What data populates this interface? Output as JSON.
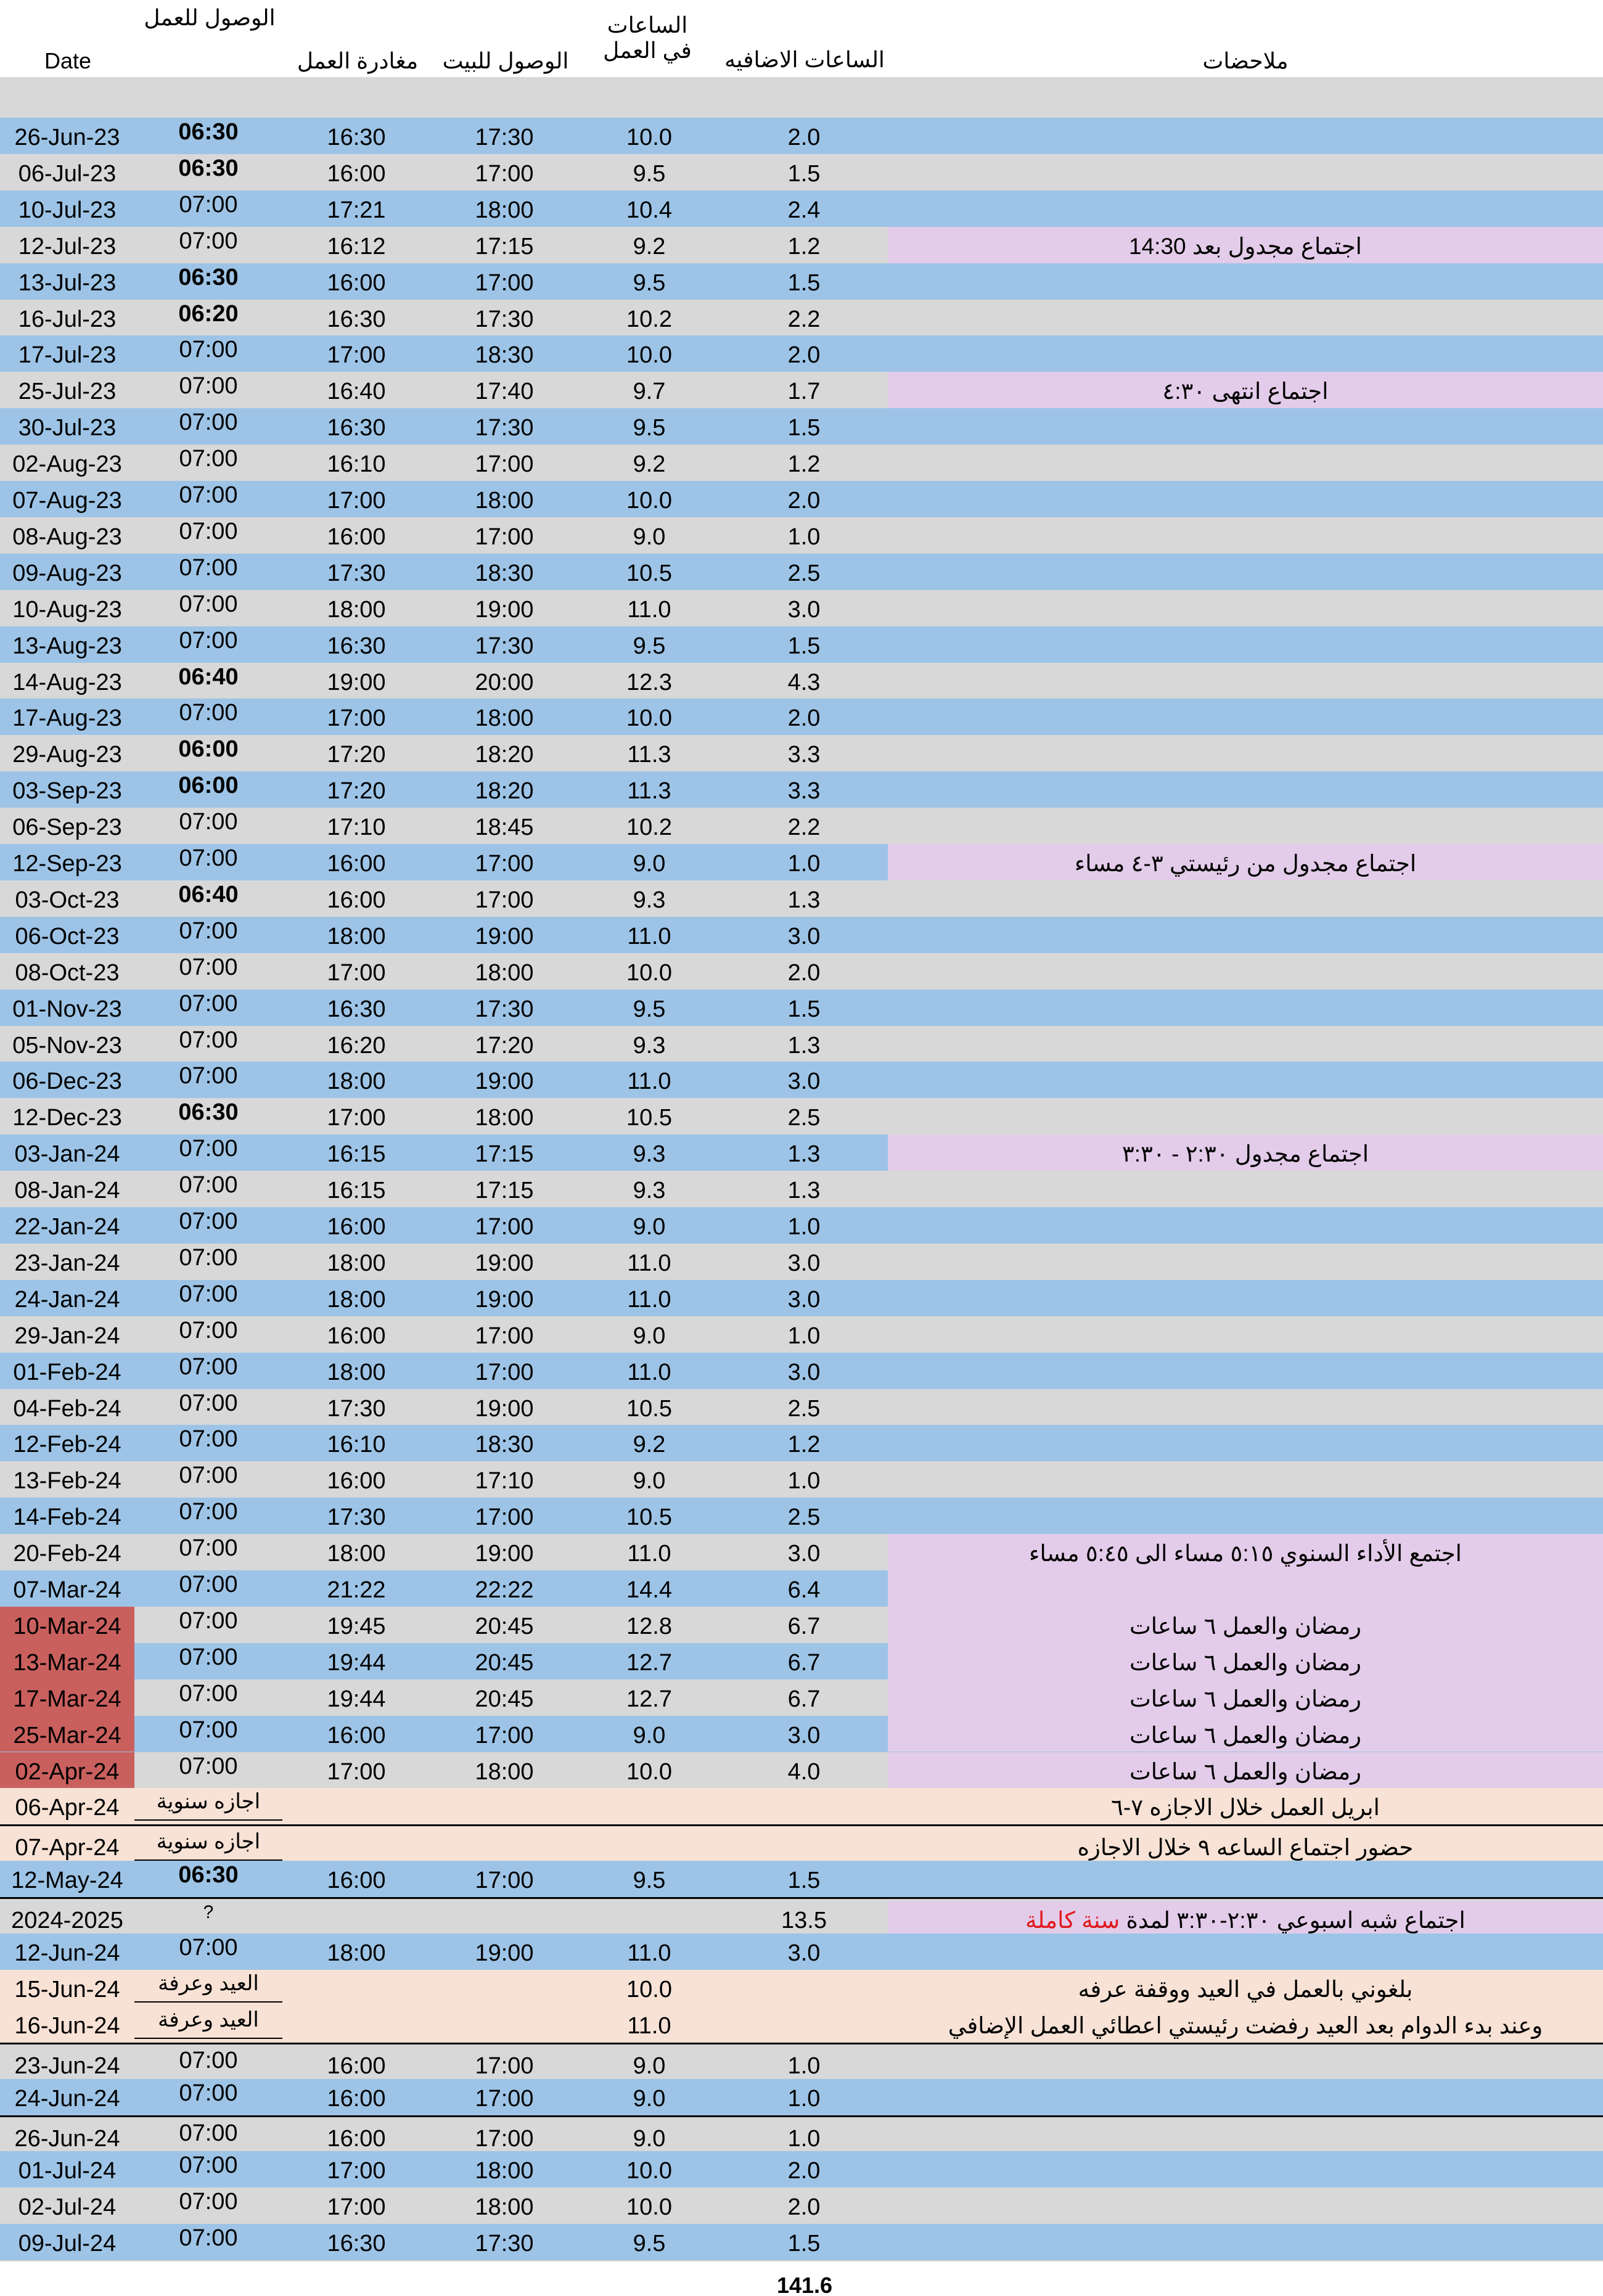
{
  "colors": {
    "blue": "#9dc4e6",
    "gray": "#d8d8d8",
    "purple": "#e3cce9",
    "peach": "#f7e2d5",
    "red_date": "#c9605e",
    "note_red": "#e0191d"
  },
  "headers": {
    "date": "Date",
    "arrive_work": "الوصول للعمل",
    "leave_work": "مغادرة العمل",
    "arrive_home": "الوصول للبيت",
    "hours_work": "الساعات في العمل",
    "overtime": "الساعات الاضافيه",
    "notes": "ملاحضات"
  },
  "rows": [
    {
      "date": "26-Jun-23",
      "arrive": "06:30",
      "bold": true,
      "leave": "16:30",
      "home": "17:30",
      "hours": "10.0",
      "ot": "2.0",
      "bg": "blue"
    },
    {
      "date": "06-Jul-23",
      "arrive": "06:30",
      "bold": true,
      "leave": "16:00",
      "home": "17:00",
      "hours": "9.5",
      "ot": "1.5",
      "bg": "gray"
    },
    {
      "date": "10-Jul-23",
      "arrive": "07:00",
      "leave": "17:21",
      "home": "18:00",
      "hours": "10.4",
      "ot": "2.4",
      "bg": "blue"
    },
    {
      "date": "12-Jul-23",
      "arrive": "07:00",
      "leave": "16:12",
      "home": "17:15",
      "hours": "9.2",
      "ot": "1.2",
      "bg": "gray",
      "note": "اجتماع مجدول بعد 14:30",
      "note_bg": "purple"
    },
    {
      "date": "13-Jul-23",
      "arrive": "06:30",
      "bold": true,
      "leave": "16:00",
      "home": "17:00",
      "hours": "9.5",
      "ot": "1.5",
      "bg": "blue"
    },
    {
      "date": "16-Jul-23",
      "arrive": "06:20",
      "bold": true,
      "leave": "16:30",
      "home": "17:30",
      "hours": "10.2",
      "ot": "2.2",
      "bg": "gray"
    },
    {
      "date": "17-Jul-23",
      "arrive": "07:00",
      "leave": "17:00",
      "home": "18:30",
      "hours": "10.0",
      "ot": "2.0",
      "bg": "blue"
    },
    {
      "date": "25-Jul-23",
      "arrive": "07:00",
      "leave": "16:40",
      "home": "17:40",
      "hours": "9.7",
      "ot": "1.7",
      "bg": "gray",
      "note": "اجتماع انتهى ٤:٣٠",
      "note_bg": "purple"
    },
    {
      "date": "30-Jul-23",
      "arrive": "07:00",
      "leave": "16:30",
      "home": "17:30",
      "hours": "9.5",
      "ot": "1.5",
      "bg": "blue"
    },
    {
      "date": "02-Aug-23",
      "arrive": "07:00",
      "leave": "16:10",
      "home": "17:00",
      "hours": "9.2",
      "ot": "1.2",
      "bg": "gray"
    },
    {
      "date": "07-Aug-23",
      "arrive": "07:00",
      "leave": "17:00",
      "home": "18:00",
      "hours": "10.0",
      "ot": "2.0",
      "bg": "blue"
    },
    {
      "date": "08-Aug-23",
      "arrive": "07:00",
      "leave": "16:00",
      "home": "17:00",
      "hours": "9.0",
      "ot": "1.0",
      "bg": "gray"
    },
    {
      "date": "09-Aug-23",
      "arrive": "07:00",
      "leave": "17:30",
      "home": "18:30",
      "hours": "10.5",
      "ot": "2.5",
      "bg": "blue"
    },
    {
      "date": "10-Aug-23",
      "arrive": "07:00",
      "leave": "18:00",
      "home": "19:00",
      "hours": "11.0",
      "ot": "3.0",
      "bg": "gray"
    },
    {
      "date": "13-Aug-23",
      "arrive": "07:00",
      "leave": "16:30",
      "home": "17:30",
      "hours": "9.5",
      "ot": "1.5",
      "bg": "blue"
    },
    {
      "date": "14-Aug-23",
      "arrive": "06:40",
      "bold": true,
      "leave": "19:00",
      "home": "20:00",
      "hours": "12.3",
      "ot": "4.3",
      "bg": "gray"
    },
    {
      "date": "17-Aug-23",
      "arrive": "07:00",
      "leave": "17:00",
      "home": "18:00",
      "hours": "10.0",
      "ot": "2.0",
      "bg": "blue"
    },
    {
      "date": "29-Aug-23",
      "arrive": "06:00",
      "bold": true,
      "leave": "17:20",
      "home": "18:20",
      "hours": "11.3",
      "ot": "3.3",
      "bg": "gray"
    },
    {
      "date": "03-Sep-23",
      "arrive": "06:00",
      "bold": true,
      "leave": "17:20",
      "home": "18:20",
      "hours": "11.3",
      "ot": "3.3",
      "bg": "blue"
    },
    {
      "date": "06-Sep-23",
      "arrive": "07:00",
      "leave": "17:10",
      "home": "18:45",
      "hours": "10.2",
      "ot": "2.2",
      "bg": "gray"
    },
    {
      "date": "12-Sep-23",
      "arrive": "07:00",
      "leave": "16:00",
      "home": "17:00",
      "hours": "9.0",
      "ot": "1.0",
      "bg": "blue",
      "note": "اجتماع مجدول من رئيستي ٣-٤ مساء",
      "note_bg": "purple"
    },
    {
      "date": "03-Oct-23",
      "arrive": "06:40",
      "bold": true,
      "leave": "16:00",
      "home": "17:00",
      "hours": "9.3",
      "ot": "1.3",
      "bg": "gray"
    },
    {
      "date": "06-Oct-23",
      "arrive": "07:00",
      "leave": "18:00",
      "home": "19:00",
      "hours": "11.0",
      "ot": "3.0",
      "bg": "blue"
    },
    {
      "date": "08-Oct-23",
      "arrive": "07:00",
      "leave": "17:00",
      "home": "18:00",
      "hours": "10.0",
      "ot": "2.0",
      "bg": "gray"
    },
    {
      "date": "01-Nov-23",
      "arrive": "07:00",
      "leave": "16:30",
      "home": "17:30",
      "hours": "9.5",
      "ot": "1.5",
      "bg": "blue"
    },
    {
      "date": "05-Nov-23",
      "arrive": "07:00",
      "leave": "16:20",
      "home": "17:20",
      "hours": "9.3",
      "ot": "1.3",
      "bg": "gray"
    },
    {
      "date": "06-Dec-23",
      "arrive": "07:00",
      "leave": "18:00",
      "home": "19:00",
      "hours": "11.0",
      "ot": "3.0",
      "bg": "blue"
    },
    {
      "date": "12-Dec-23",
      "arrive": "06:30",
      "bold": true,
      "leave": "17:00",
      "home": "18:00",
      "hours": "10.5",
      "ot": "2.5",
      "bg": "gray"
    },
    {
      "date": "03-Jan-24",
      "arrive": "07:00",
      "leave": "16:15",
      "home": "17:15",
      "hours": "9.3",
      "ot": "1.3",
      "bg": "blue",
      "note": "اجتماع مجدول ٢:٣٠ - ٣:٣٠",
      "note_bg": "purple"
    },
    {
      "date": "08-Jan-24",
      "arrive": "07:00",
      "leave": "16:15",
      "home": "17:15",
      "hours": "9.3",
      "ot": "1.3",
      "bg": "gray"
    },
    {
      "date": "22-Jan-24",
      "arrive": "07:00",
      "leave": "16:00",
      "home": "17:00",
      "hours": "9.0",
      "ot": "1.0",
      "bg": "blue"
    },
    {
      "date": "23-Jan-24",
      "arrive": "07:00",
      "leave": "18:00",
      "home": "19:00",
      "hours": "11.0",
      "ot": "3.0",
      "bg": "gray"
    },
    {
      "date": "24-Jan-24",
      "arrive": "07:00",
      "leave": "18:00",
      "home": "19:00",
      "hours": "11.0",
      "ot": "3.0",
      "bg": "blue"
    },
    {
      "date": "29-Jan-24",
      "arrive": "07:00",
      "leave": "16:00",
      "home": "17:00",
      "hours": "9.0",
      "ot": "1.0",
      "bg": "gray"
    },
    {
      "date": "01-Feb-24",
      "arrive": "07:00",
      "leave": "18:00",
      "home": "17:00",
      "hours": "11.0",
      "ot": "3.0",
      "bg": "blue"
    },
    {
      "date": "04-Feb-24",
      "arrive": "07:00",
      "leave": "17:30",
      "home": "19:00",
      "hours": "10.5",
      "ot": "2.5",
      "bg": "gray"
    },
    {
      "date": "12-Feb-24",
      "arrive": "07:00",
      "leave": "16:10",
      "home": "18:30",
      "hours": "9.2",
      "ot": "1.2",
      "bg": "blue"
    },
    {
      "date": "13-Feb-24",
      "arrive": "07:00",
      "leave": "16:00",
      "home": "17:10",
      "hours": "9.0",
      "ot": "1.0",
      "bg": "gray"
    },
    {
      "date": "14-Feb-24",
      "arrive": "07:00",
      "leave": "17:30",
      "home": "17:00",
      "hours": "10.5",
      "ot": "2.5",
      "bg": "blue"
    },
    {
      "date": "20-Feb-24",
      "arrive": "07:00",
      "leave": "18:00",
      "home": "19:00",
      "hours": "11.0",
      "ot": "3.0",
      "bg": "gray",
      "note": "اجتمع الأداء السنوي ٥:١٥ مساء الى ٥:٤٥ مساء",
      "note_bg": "purple"
    },
    {
      "date": "07-Mar-24",
      "arrive": "07:00",
      "leave": "21:22",
      "home": "22:22",
      "hours": "14.4",
      "ot": "6.4",
      "bg": "blue",
      "note_bg": "purple"
    },
    {
      "date": "10-Mar-24",
      "arrive": "07:00",
      "leave": "19:45",
      "home": "20:45",
      "hours": "12.8",
      "ot": "6.7",
      "bg": "gray",
      "date_bg": "red_date",
      "note": "رمضان والعمل ٦ ساعات",
      "note_bg": "purple"
    },
    {
      "date": "13-Mar-24",
      "arrive": "07:00",
      "leave": "19:44",
      "home": "20:45",
      "hours": "12.7",
      "ot": "6.7",
      "bg": "blue",
      "date_bg": "red_date",
      "note": "رمضان والعمل ٦ ساعات",
      "note_bg": "purple"
    },
    {
      "date": "17-Mar-24",
      "arrive": "07:00",
      "leave": "19:44",
      "home": "20:45",
      "hours": "12.7",
      "ot": "6.7",
      "bg": "gray",
      "date_bg": "red_date",
      "note": "رمضان والعمل ٦ ساعات",
      "note_bg": "purple"
    },
    {
      "date": "25-Mar-24",
      "arrive": "07:00",
      "leave": "16:00",
      "home": "17:00",
      "hours": "9.0",
      "ot": "3.0",
      "bg": "blue",
      "date_bg": "red_date",
      "note": "رمضان والعمل ٦ ساعات",
      "note_bg": "purple"
    },
    {
      "date": "02-Apr-24",
      "arrive": "07:00",
      "leave": "17:00",
      "home": "18:00",
      "hours": "10.0",
      "ot": "4.0",
      "bg": "gray",
      "date_bg": "red_date",
      "note": "رمضان والعمل ٦ ساعات",
      "note_bg": "purple"
    },
    {
      "date": "06-Apr-24",
      "arrive": "اجازه سنوية",
      "leave": "",
      "home": "",
      "hours": "",
      "ot": "",
      "bg": "peach",
      "note": "ابريل العمل خلال الاجازه ٧-٦",
      "note_bg": "peach"
    },
    {
      "date": "07-Apr-24",
      "arrive": "اجازه سنوية",
      "leave": "",
      "home": "",
      "hours": "",
      "ot": "",
      "bg": "peach",
      "note": "حضور اجتماع الساعه ٩ خلال الاجازه",
      "note_bg": "peach"
    },
    {
      "date": "12-May-24",
      "arrive": "06:30",
      "bold": true,
      "leave": "16:00",
      "home": "17:00",
      "hours": "9.5",
      "ot": "1.5",
      "bg": "blue"
    },
    {
      "date": "2024-2025",
      "arrive": "?",
      "leave": "",
      "home": "",
      "hours": "",
      "ot": "13.5",
      "bg": "gray",
      "note": "اجتماع شبه اسبوعي ٢:٣٠-٣:٣٠ لمدة ",
      "note_red": "سنة كاملة",
      "note_bg": "purple"
    },
    {
      "date": "12-Jun-24",
      "arrive": "07:00",
      "leave": "18:00",
      "home": "19:00",
      "hours": "11.0",
      "ot": "3.0",
      "bg": "blue"
    },
    {
      "date": "15-Jun-24",
      "arrive": "العيد وعرفة",
      "leave": "",
      "home": "",
      "hours": "10.0",
      "ot": "",
      "bg": "peach",
      "note": "بلغوني بالعمل في العيد ووقفة عرفه",
      "note_bg": "peach"
    },
    {
      "date": "16-Jun-24",
      "arrive": "العيد وعرفة",
      "leave": "",
      "home": "",
      "hours": "11.0",
      "ot": "",
      "bg": "peach",
      "note": "وعند بدء الدوام بعد العيد رفضت رئيستي اعطائي العمل الإضافي",
      "note_bg": "peach"
    },
    {
      "date": "23-Jun-24",
      "arrive": "07:00",
      "leave": "16:00",
      "home": "17:00",
      "hours": "9.0",
      "ot": "1.0",
      "bg": "gray"
    },
    {
      "date": "24-Jun-24",
      "arrive": "07:00",
      "leave": "16:00",
      "home": "17:00",
      "hours": "9.0",
      "ot": "1.0",
      "bg": "blue"
    },
    {
      "date": "26-Jun-24",
      "arrive": "07:00",
      "leave": "16:00",
      "home": "17:00",
      "hours": "9.0",
      "ot": "1.0",
      "bg": "gray"
    },
    {
      "date": "01-Jul-24",
      "arrive": "07:00",
      "leave": "17:00",
      "home": "18:00",
      "hours": "10.0",
      "ot": "2.0",
      "bg": "blue"
    },
    {
      "date": "02-Jul-24",
      "arrive": "07:00",
      "leave": "17:00",
      "home": "18:00",
      "hours": "10.0",
      "ot": "2.0",
      "bg": "gray"
    },
    {
      "date": "09-Jul-24",
      "arrive": "07:00",
      "leave": "16:30",
      "home": "17:30",
      "hours": "9.5",
      "ot": "1.5",
      "bg": "blue"
    }
  ],
  "total": "141.6"
}
